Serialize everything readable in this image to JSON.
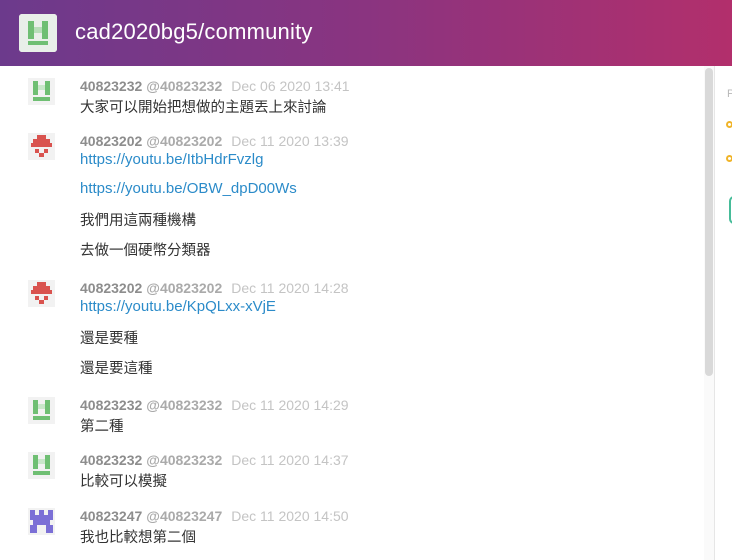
{
  "room": {
    "title": "cad2020bg5/community",
    "avatar_icon": "identicon-green"
  },
  "messages": [
    {
      "user": "40823232",
      "handle": "@40823232",
      "time": "Dec 06 2020 13:41",
      "avatar": "identicon-green",
      "lines": [
        {
          "text": "大家可以開始把想做的主題丟上來討論",
          "link": false
        }
      ]
    },
    {
      "user": "40823202",
      "handle": "@40823202",
      "time": "Dec 11 2020 13:39",
      "avatar": "identicon-red",
      "lines": [
        {
          "text": "https://youtu.be/ItbHdrFvzlg",
          "link": true
        },
        {
          "text": "https://youtu.be/OBW_dpD00Ws",
          "link": true
        },
        {
          "text": "我們用這兩種機構",
          "link": false
        },
        {
          "text": "去做一個硬幣分類器",
          "link": false
        }
      ]
    },
    {
      "user": "40823202",
      "handle": "@40823202",
      "time": "Dec 11 2020 14:28",
      "avatar": "identicon-red",
      "lines": [
        {
          "text": "https://youtu.be/KpQLxx-xVjE",
          "link": true
        },
        {
          "text": "還是要種",
          "link": false
        },
        {
          "text": "還是要這種",
          "link": false
        }
      ]
    },
    {
      "user": "40823232",
      "handle": "@40823232",
      "time": "Dec 11 2020 14:29",
      "avatar": "identicon-green",
      "lines": [
        {
          "text": "第二種",
          "link": false
        }
      ]
    },
    {
      "user": "40823232",
      "handle": "@40823232",
      "time": "Dec 11 2020 14:37",
      "avatar": "identicon-green",
      "lines": [
        {
          "text": "比較可以模擬",
          "link": false
        }
      ]
    },
    {
      "user": "40823247",
      "handle": "@40823247",
      "time": "Dec 11 2020 14:50",
      "avatar": "identicon-purple",
      "lines": [
        {
          "text": "我也比較想第二個",
          "link": false
        }
      ]
    }
  ],
  "right_panel": {
    "label_letter": "P"
  },
  "colors": {
    "header_start": "#6c3a8c",
    "header_end": "#b22f6c",
    "link": "#2b8bc9",
    "identicon_green": "#6fbf73",
    "identicon_red": "#d9534f",
    "identicon_purple": "#7b6fd6"
  }
}
